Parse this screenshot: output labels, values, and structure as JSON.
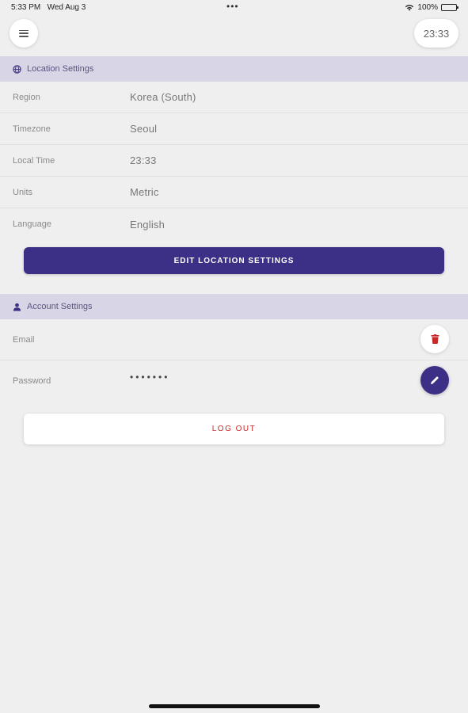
{
  "status_bar": {
    "time": "5:33 PM",
    "date": "Wed Aug 3",
    "dots": "•••",
    "battery": "100%"
  },
  "header": {
    "menu_icon": "hamburger-icon",
    "clock": "23:33"
  },
  "location_settings": {
    "title": "Location Settings",
    "icon": "globe-icon",
    "rows": [
      {
        "label": "Region",
        "value": "Korea (South)"
      },
      {
        "label": "Timezone",
        "value": "Seoul"
      },
      {
        "label": "Local Time",
        "value": "23:33"
      },
      {
        "label": "Units",
        "value": "Metric"
      },
      {
        "label": "Language",
        "value": "English"
      }
    ],
    "edit_button": "EDIT LOCATION SETTINGS"
  },
  "account_settings": {
    "title": "Account Settings",
    "icon": "person-icon",
    "email_label": "Email",
    "password_label": "Password",
    "password_value": "•••••••",
    "delete_icon": "trash-icon",
    "edit_icon": "pencil-icon"
  },
  "logout_button": "LOG OUT",
  "colors": {
    "accent": "#3c2f86",
    "section_bg": "#d8d6e6",
    "logout_text": "#c62828",
    "delete_icon": "#c62828"
  }
}
